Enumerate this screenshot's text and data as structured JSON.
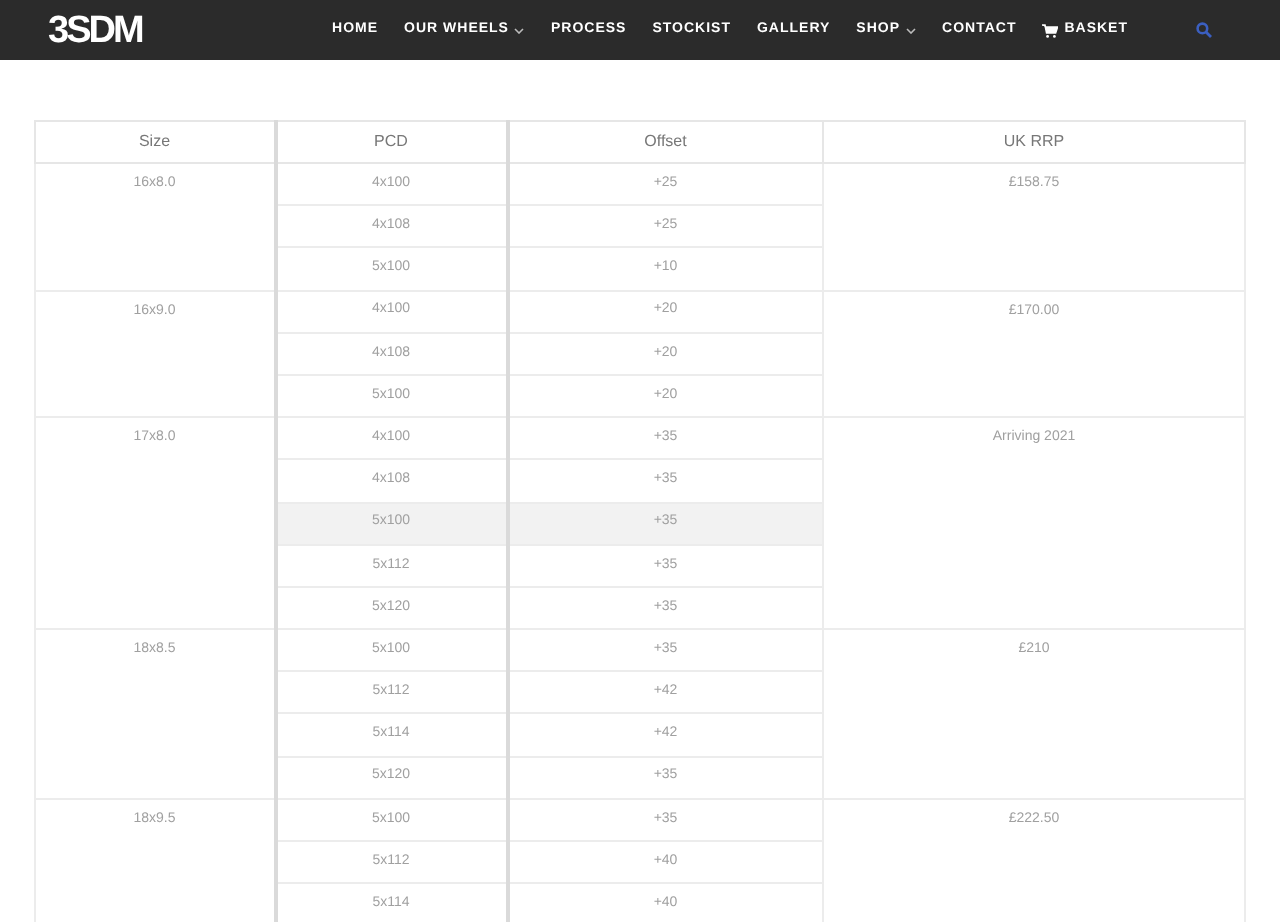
{
  "header": {
    "logo": "3SDM",
    "nav": [
      {
        "label": "HOME",
        "dropdown": false,
        "kind": "link"
      },
      {
        "label": "OUR WHEELS",
        "dropdown": true,
        "kind": "link"
      },
      {
        "label": "PROCESS",
        "dropdown": false,
        "kind": "link"
      },
      {
        "label": "STOCKIST",
        "dropdown": false,
        "kind": "link"
      },
      {
        "label": "GALLERY",
        "dropdown": false,
        "kind": "link"
      },
      {
        "label": "SHOP",
        "dropdown": true,
        "kind": "link"
      },
      {
        "label": "CONTACT",
        "dropdown": false,
        "kind": "link"
      },
      {
        "label": "BASKET",
        "dropdown": false,
        "kind": "basket"
      }
    ]
  },
  "table": {
    "columns": [
      "Size",
      "PCD",
      "Offset",
      "UK RRP"
    ],
    "groups": [
      {
        "size": "16x8.0",
        "price": "£158.75",
        "rows": [
          {
            "pcd": "4x100",
            "offset": "+25",
            "highlighted": false
          },
          {
            "pcd": "4x108",
            "offset": "+25",
            "highlighted": false
          },
          {
            "pcd": "5x100",
            "offset": "+10",
            "highlighted": false
          }
        ]
      },
      {
        "size": "16x9.0",
        "price": "£170.00",
        "rows": [
          {
            "pcd": "4x100",
            "offset": "+20",
            "highlighted": false
          },
          {
            "pcd": "4x108",
            "offset": "+20",
            "highlighted": false
          },
          {
            "pcd": "5x100",
            "offset": "+20",
            "highlighted": false
          }
        ]
      },
      {
        "size": "17x8.0",
        "price": "Arriving 2021",
        "rows": [
          {
            "pcd": "4x100",
            "offset": "+35",
            "highlighted": false
          },
          {
            "pcd": "4x108",
            "offset": "+35",
            "highlighted": false
          },
          {
            "pcd": "5x100",
            "offset": "+35",
            "highlighted": true
          },
          {
            "pcd": "5x112",
            "offset": "+35",
            "highlighted": false
          },
          {
            "pcd": "5x120",
            "offset": "+35",
            "highlighted": false
          }
        ]
      },
      {
        "size": "18x8.5",
        "price": "£210",
        "rows": [
          {
            "pcd": "5x100",
            "offset": "+35",
            "highlighted": false
          },
          {
            "pcd": "5x112",
            "offset": "+42",
            "highlighted": false
          },
          {
            "pcd": "5x114",
            "offset": "+42",
            "highlighted": false
          },
          {
            "pcd": "5x120",
            "offset": "+35",
            "highlighted": false
          }
        ]
      },
      {
        "size": "18x9.5",
        "price": "£222.50",
        "rows": [
          {
            "pcd": "5x100",
            "offset": "+35",
            "highlighted": false
          },
          {
            "pcd": "5x112",
            "offset": "+40",
            "highlighted": false
          },
          {
            "pcd": "5x114",
            "offset": "+40",
            "highlighted": false
          }
        ]
      }
    ]
  }
}
